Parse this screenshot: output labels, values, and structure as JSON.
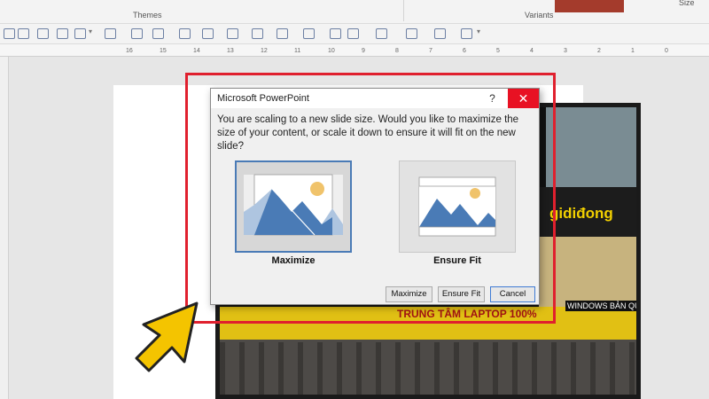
{
  "ribbon": {
    "themes_label": "Themes",
    "variants_label": "Variants",
    "size_label": "Size",
    "accent_color": "#a43b2c"
  },
  "ruler": {
    "ticks": [
      "16",
      "15",
      "14",
      "13",
      "12",
      "11",
      "10",
      "9",
      "8",
      "7",
      "6",
      "5",
      "4",
      "3",
      "2",
      "1",
      "0"
    ]
  },
  "photo": {
    "banner_text": "TRUNG TÂM LAPTOP 100%",
    "sign_text": "WINDOWS BẢN QU",
    "brand_text": "gidiđong"
  },
  "dialog": {
    "title": "Microsoft PowerPoint",
    "help_label": "?",
    "close_label": "✕",
    "message": "You are scaling to a new slide size.  Would you like to maximize the size of your content, or scale it down to ensure it will fit on the new slide?",
    "options": [
      {
        "label": "Maximize",
        "selected": true,
        "icon": "maximize-preview-icon"
      },
      {
        "label": "Ensure Fit",
        "selected": false,
        "icon": "ensure-fit-preview-icon"
      }
    ],
    "buttons": {
      "maximize": "Maximize",
      "ensure_fit": "Ensure Fit",
      "cancel": "Cancel"
    }
  },
  "annotation": {
    "highlight_color": "#e0202e",
    "arrow_color": "#f4c400",
    "arrow_icon": "pointer-arrow-icon"
  }
}
